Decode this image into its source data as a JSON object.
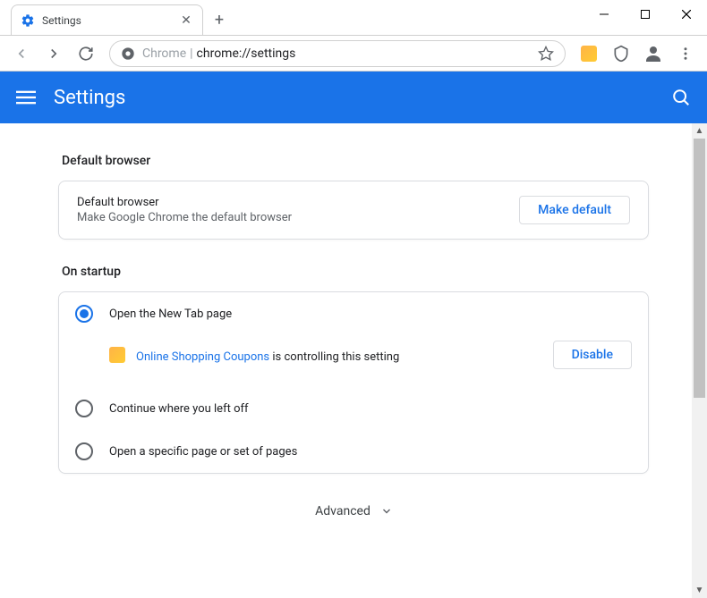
{
  "window": {
    "tab_title": "Settings"
  },
  "omnibox": {
    "prefix": "Chrome",
    "url": "chrome://settings"
  },
  "header": {
    "title": "Settings"
  },
  "sections": {
    "default_browser": {
      "title": "Default browser",
      "row_label": "Default browser",
      "row_sub": "Make Google Chrome the default browser",
      "button": "Make default"
    },
    "on_startup": {
      "title": "On startup",
      "opt1": "Open the New Tab page",
      "opt2": "Continue where you left off",
      "opt3": "Open a specific page or set of pages",
      "extension_name": "Online Shopping Coupons",
      "extension_notice": " is controlling this setting",
      "disable_button": "Disable"
    }
  },
  "advanced": "Advanced"
}
